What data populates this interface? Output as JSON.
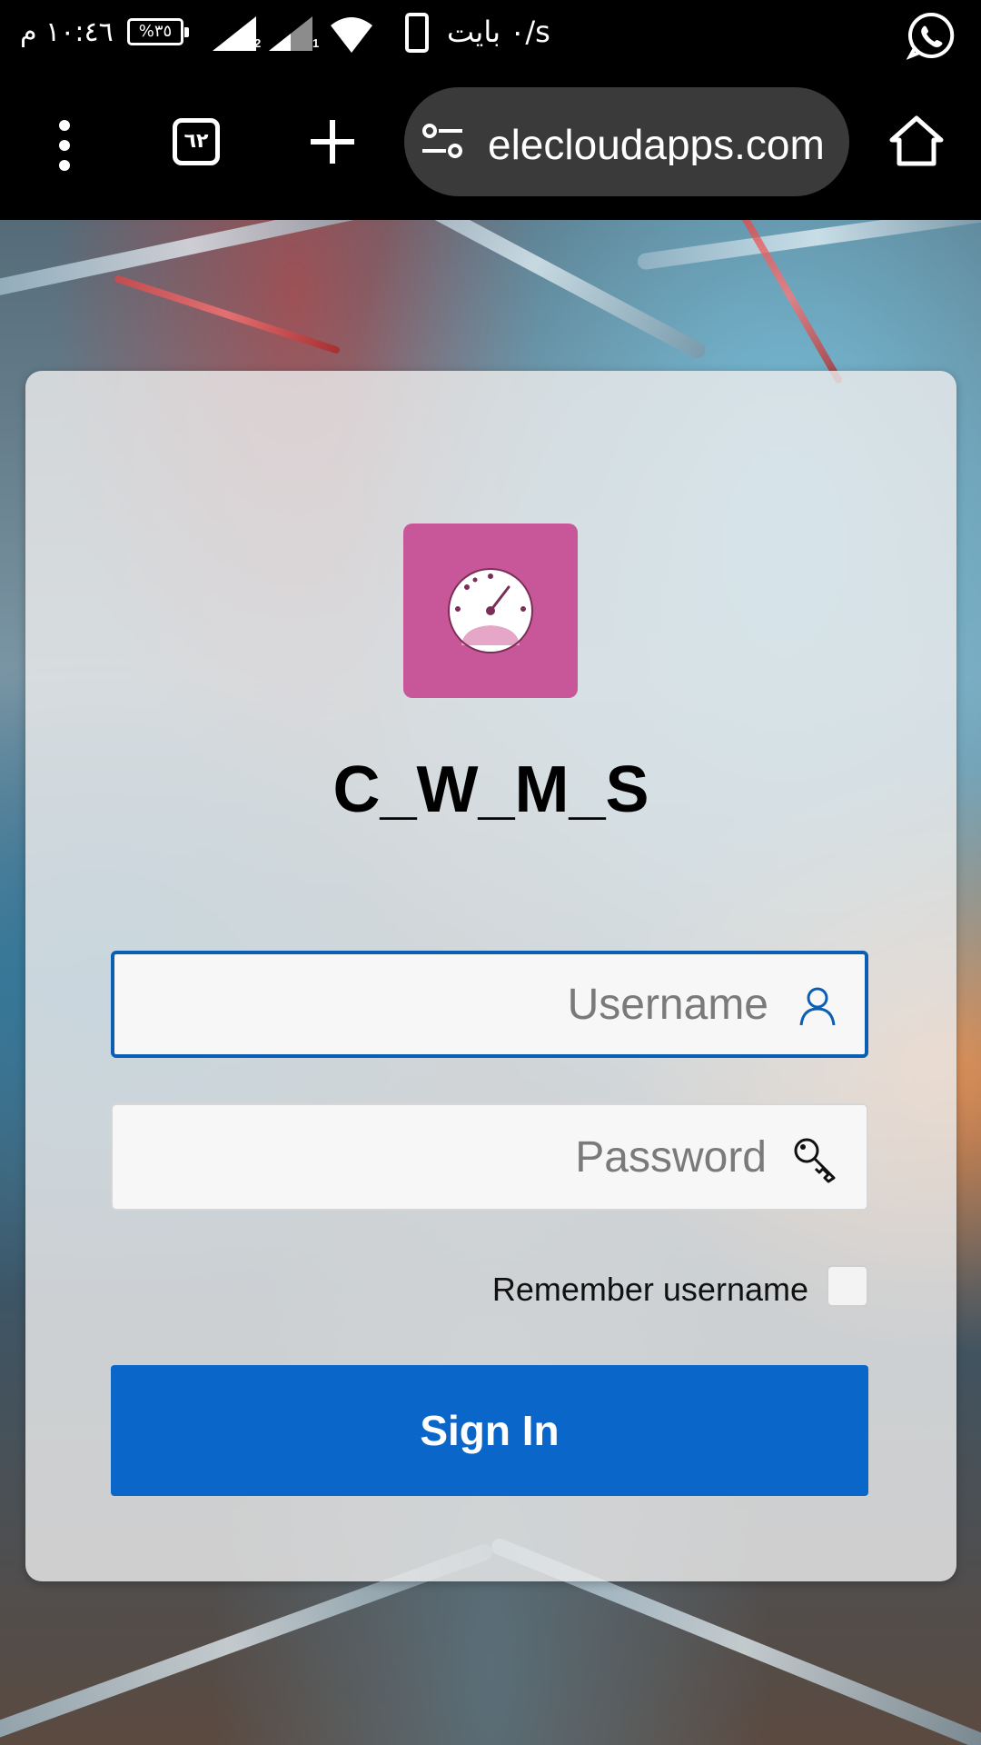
{
  "status_bar": {
    "time": "١٠:٤٦ م",
    "battery": "%٣٥",
    "sim1_label": "2",
    "sim2_label": "1",
    "net_speed": "٠ بايت/s"
  },
  "browser": {
    "tab_count": "٦٢",
    "url": "elecloudapps.com"
  },
  "login": {
    "app_title": "C_W_M_S",
    "username_placeholder": "Username",
    "username_value": "",
    "password_placeholder": "Password",
    "password_value": "",
    "remember_label": "Remember username",
    "remember_checked": false,
    "signin_label": "Sign In"
  },
  "colors": {
    "logo_bg": "#c8579a",
    "primary": "#0a66c8",
    "focus_border": "#0a5fb4"
  }
}
